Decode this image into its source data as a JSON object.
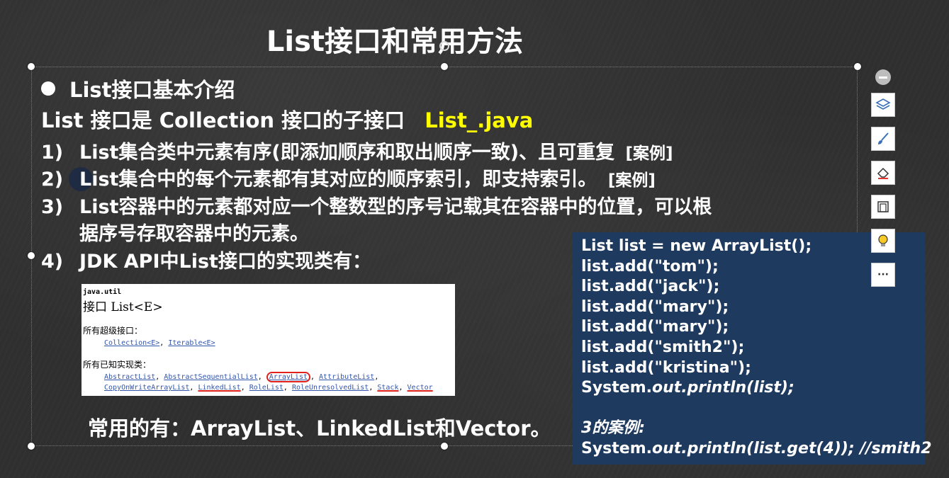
{
  "slide": {
    "title": "List接口和常用方法",
    "bullet_heading": "List接口基本介绍",
    "intro_prefix": "List 接口是 Collection 接口的子接口",
    "intro_file": "List_.java",
    "items": [
      {
        "num": "1)",
        "text": "List集合类中元素有序(即添加顺序和取出顺序一致)、且可重复",
        "tag": "[案例]"
      },
      {
        "num": "2)",
        "text": "List集合中的每个元素都有其对应的顺序索引，即支持索引。",
        "tag": "[案例]"
      },
      {
        "num": "3)",
        "text": "List容器中的元素都对应一个整数型的序号记载其在容器中的位置，可以根",
        "tag": ""
      },
      {
        "num": "",
        "text": "据序号存取容器中的元素。",
        "tag": ""
      },
      {
        "num": "4)",
        "text": "JDK API中List接口的实现类有：",
        "tag": ""
      }
    ],
    "bottom_text": "常用的有：ArrayList、LinkedList和Vector。"
  },
  "javadoc": {
    "package": "java.util",
    "interface_title": "接口 List<E>",
    "super_label": "所有超级接口：",
    "super_interfaces": [
      "Collection<E>",
      "Iterable<E>"
    ],
    "impl_label": "所有已知实现类：",
    "impl_row1": [
      "AbstractList",
      "AbstractSequentialList",
      "ArrayList",
      "AttributeList"
    ],
    "impl_row2": [
      "CopyOnWriteArrayList",
      "LinkedList",
      "RoleList",
      "RoleUnresolvedList",
      "Stack",
      "Vector"
    ]
  },
  "code": {
    "lines": [
      "List list = new ArrayList();",
      "list.add(\"tom\");",
      "list.add(\"jack\");",
      "list.add(\"mary\");",
      "list.add(\"mary\");",
      "list.add(\"smith2\");",
      "list.add(\"kristina\");"
    ],
    "print_prefix": "System.",
    "print_rest": "out.println(list);",
    "case_label": "3的案例:",
    "get_prefix": "System.",
    "get_rest": "out.println(list.get(4)); //smith2"
  },
  "toolbar": {
    "icons": [
      "minus-icon",
      "layers-icon",
      "brush-icon",
      "eraser-icon",
      "frame-icon",
      "lightbulb-icon",
      "more-icon"
    ],
    "more_label": "···"
  }
}
